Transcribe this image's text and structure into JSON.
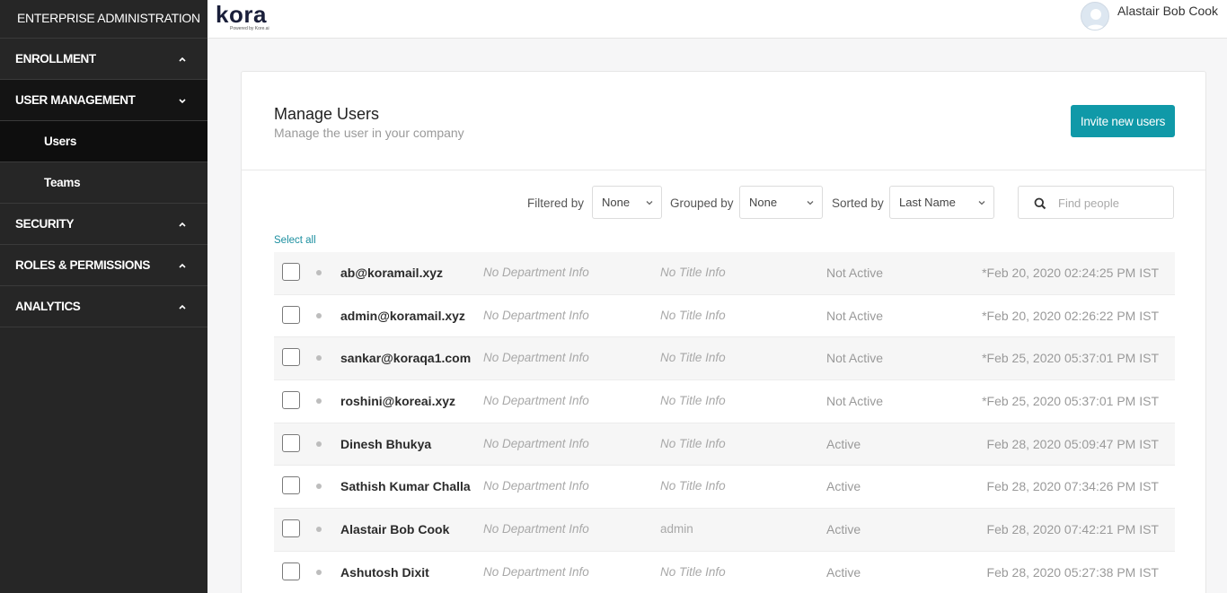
{
  "sidebar": {
    "title": "ENTERPRISE ADMINISTRATION",
    "sections": [
      {
        "label": "ENROLLMENT"
      },
      {
        "label": "USER MANAGEMENT",
        "items": [
          {
            "label": "Users"
          },
          {
            "label": "Teams"
          }
        ]
      },
      {
        "label": "SECURITY"
      },
      {
        "label": "ROLES & PERMISSIONS"
      },
      {
        "label": "ANALYTICS"
      }
    ]
  },
  "header": {
    "logo_text": "kora",
    "logo_tagline": "Powered by Kore.ai",
    "user_name": "Alastair Bob Cook"
  },
  "page": {
    "title": "Manage Users",
    "subtitle": "Manage the user in your company",
    "invite_button": "Invite new users",
    "select_all": "Select all"
  },
  "filters": {
    "filtered_by_label": "Filtered by",
    "filtered_by_value": "None",
    "grouped_by_label": "Grouped by",
    "grouped_by_value": "None",
    "sorted_by_label": "Sorted by",
    "sorted_by_value": "Last Name",
    "search_placeholder": "Find people"
  },
  "users": [
    {
      "name": "ab@koramail.xyz",
      "department": "No Department Info",
      "title": "No Title Info",
      "status": "Not Active",
      "date": "*Feb 20, 2020 02:24:25 PM IST"
    },
    {
      "name": "admin@koramail.xyz",
      "department": "No Department Info",
      "title": "No Title Info",
      "status": "Not Active",
      "date": "*Feb 20, 2020 02:26:22 PM IST"
    },
    {
      "name": "sankar@koraqa1.com",
      "department": "No Department Info",
      "title": "No Title Info",
      "status": "Not Active",
      "date": "*Feb 25, 2020 05:37:01 PM IST"
    },
    {
      "name": "roshini@koreai.xyz",
      "department": "No Department Info",
      "title": "No Title Info",
      "status": "Not Active",
      "date": "*Feb 25, 2020 05:37:01 PM IST"
    },
    {
      "name": "Dinesh Bhukya",
      "department": "No Department Info",
      "title": "No Title Info",
      "status": "Active",
      "date": "Feb 28, 2020 05:09:47 PM IST"
    },
    {
      "name": "Sathish Kumar Challa",
      "department": "No Department Info",
      "title": "No Title Info",
      "status": "Active",
      "date": "Feb 28, 2020 07:34:26 PM IST"
    },
    {
      "name": "Alastair Bob Cook",
      "department": "No Department Info",
      "title": "admin",
      "status": "Active",
      "date": "Feb 28, 2020 07:42:21 PM IST"
    },
    {
      "name": "Ashutosh Dixit",
      "department": "No Department Info",
      "title": "No Title Info",
      "status": "Active",
      "date": "Feb 28, 2020 05:27:38 PM IST"
    }
  ]
}
